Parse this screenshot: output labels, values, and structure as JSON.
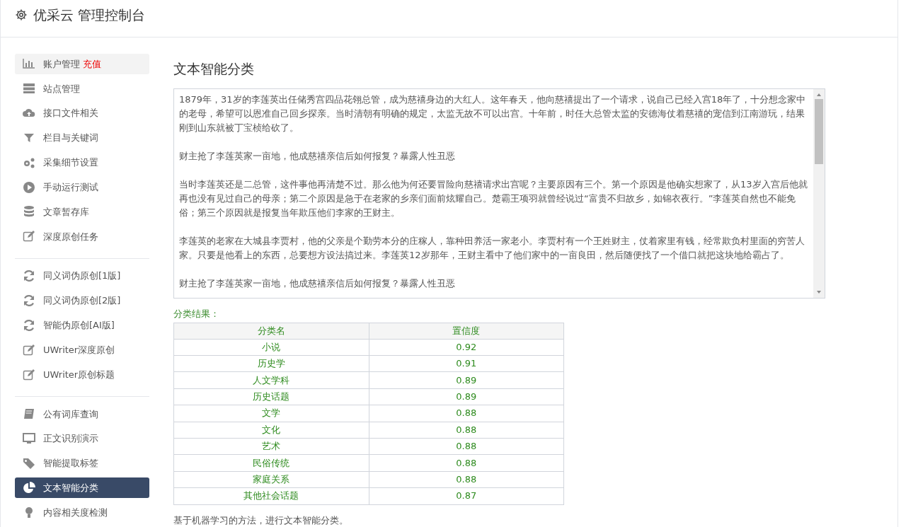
{
  "header": {
    "title": "优采云 管理控制台"
  },
  "sidebar": {
    "groups": [
      {
        "items": [
          {
            "label": "账户管理",
            "badge": "充值",
            "kind": "chart",
            "selected": false,
            "highlighted": true
          },
          {
            "label": "站点管理",
            "kind": "server",
            "selected": false,
            "highlighted": false
          },
          {
            "label": "接口文件相关",
            "kind": "cloud",
            "selected": false,
            "highlighted": false
          },
          {
            "label": "栏目与关键词",
            "kind": "filter",
            "selected": false,
            "highlighted": false
          },
          {
            "label": "采集细节设置",
            "kind": "gears",
            "selected": false,
            "highlighted": false
          },
          {
            "label": "手动运行测试",
            "kind": "play",
            "selected": false,
            "highlighted": false
          },
          {
            "label": "文章暂存库",
            "kind": "database",
            "selected": false,
            "highlighted": false
          },
          {
            "label": "深度原创任务",
            "kind": "edit",
            "selected": false,
            "highlighted": false
          }
        ]
      },
      {
        "items": [
          {
            "label": "同义词伪原创[1版]",
            "kind": "refresh",
            "selected": false,
            "highlighted": false
          },
          {
            "label": "同义词伪原创[2版]",
            "kind": "refresh",
            "selected": false,
            "highlighted": false
          },
          {
            "label": "智能伪原创[AI版]",
            "kind": "refresh",
            "selected": false,
            "highlighted": false
          },
          {
            "label": "UWriter深度原创",
            "kind": "edit",
            "selected": false,
            "highlighted": false
          },
          {
            "label": "UWriter原创标题",
            "kind": "edit",
            "selected": false,
            "highlighted": false
          }
        ]
      },
      {
        "items": [
          {
            "label": "公有词库查询",
            "kind": "book",
            "selected": false,
            "highlighted": false
          },
          {
            "label": "正文识别演示",
            "kind": "monitor",
            "selected": false,
            "highlighted": false
          },
          {
            "label": "智能提取标签",
            "kind": "tag",
            "selected": false,
            "highlighted": false
          },
          {
            "label": "文本智能分类",
            "kind": "pie",
            "selected": true,
            "highlighted": false
          },
          {
            "label": "内容相关度检测",
            "kind": "bulb",
            "selected": false,
            "highlighted": false
          }
        ]
      }
    ]
  },
  "main": {
    "title": "文本智能分类",
    "text": [
      "1879年，31岁的李莲英出任储秀宫四品花翎总管，成为慈禧身边的大红人。这年春天，他向慈禧提出了一个请求，说自己已经入宫18年了，十分想念家中的老母，希望可以恩准自己回乡探亲。当时清朝有明确的规定，太监无故不可以出宫。十年前，时任大总管太监的安德海仗着慈禧的宠信到江南游玩，结果刚到山东就被丁宝桢给砍了。",
      "财主抢了李莲英家一亩地，他成慈禧亲信后如何报复？暴露人性丑恶",
      "当时李莲英还是二总管，这件事他再清楚不过。那么他为何还要冒险向慈禧请求出宫呢？主要原因有三个。第一个原因是他确实想家了，从13岁入宫后他就再也没有见过自己的母亲；第二个原因是急于在老家的乡亲们面前炫耀自己。楚霸王项羽就曾经说过“富贵不归故乡，如锦衣夜行。”李莲英自然也不能免俗；第三个原因就是报复当年欺压他们李家的王财主。",
      "李莲英的老家在大城县李贾村，他的父亲是个勤劳本分的庄稼人，靠种田养活一家老小。李贾村有一个王姓财主，仗着家里有钱，经常欺负村里面的穷苦人家。只要是他看上的东西，总要想方设法搞过来。李莲英12岁那年，王财主看中了他们家中的一亩良田，然后随便找了一个借口就把这块地给霸占了。",
      "财主抢了李莲英家一亩地，他成慈禧亲信后如何报复？暴露人性丑恶"
    ],
    "result_label": "分类结果：",
    "table": {
      "columns": [
        "分类名",
        "置信度"
      ],
      "rows": [
        [
          "小说",
          "0.92"
        ],
        [
          "历史学",
          "0.91"
        ],
        [
          "人文学科",
          "0.89"
        ],
        [
          "历史话题",
          "0.89"
        ],
        [
          "文学",
          "0.88"
        ],
        [
          "文化",
          "0.88"
        ],
        [
          "艺术",
          "0.88"
        ],
        [
          "民俗传统",
          "0.88"
        ],
        [
          "家庭关系",
          "0.88"
        ],
        [
          "其他社会话题",
          "0.87"
        ]
      ]
    },
    "footnote": "基于机器学习的方法，进行文本智能分类。"
  }
}
